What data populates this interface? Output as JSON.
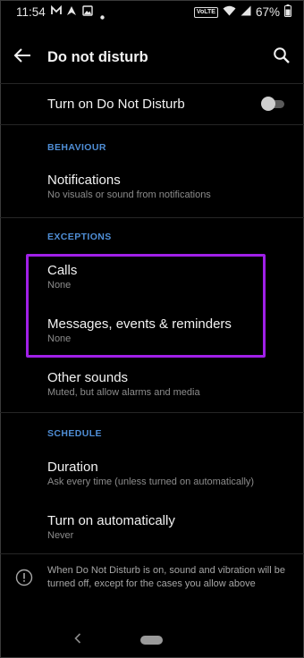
{
  "status_bar": {
    "time": "11:54",
    "notification_icons": [
      "gmail-icon",
      "navigation-icon",
      "photos-icon",
      "dot-icon"
    ],
    "volte_label": "VoLTE",
    "battery_percent": "67%"
  },
  "toolbar": {
    "title": "Do not disturb"
  },
  "toggle_row": {
    "label": "Turn on Do Not Disturb",
    "enabled": false
  },
  "behaviour": {
    "header": "BEHAVIOUR",
    "notifications": {
      "title": "Notifications",
      "subtitle": "No visuals or sound from notifications"
    }
  },
  "exceptions": {
    "header": "EXCEPTIONS",
    "calls": {
      "title": "Calls",
      "subtitle": "None"
    },
    "messages": {
      "title": "Messages, events & reminders",
      "subtitle": "None"
    },
    "other_sounds": {
      "title": "Other sounds",
      "subtitle": "Muted, but allow alarms and media"
    }
  },
  "schedule": {
    "header": "SCHEDULE",
    "duration": {
      "title": "Duration",
      "subtitle": "Ask every time (unless turned on automatically)"
    },
    "turn_on_auto": {
      "title": "Turn on automatically",
      "subtitle": "Never"
    }
  },
  "footer": {
    "info_text": "When Do Not Disturb is on, sound and vibration will be turned off, except for the cases you allow above"
  },
  "colors": {
    "accent": "#4f8ed6",
    "highlight": "#a020e8",
    "background": "#000000"
  }
}
